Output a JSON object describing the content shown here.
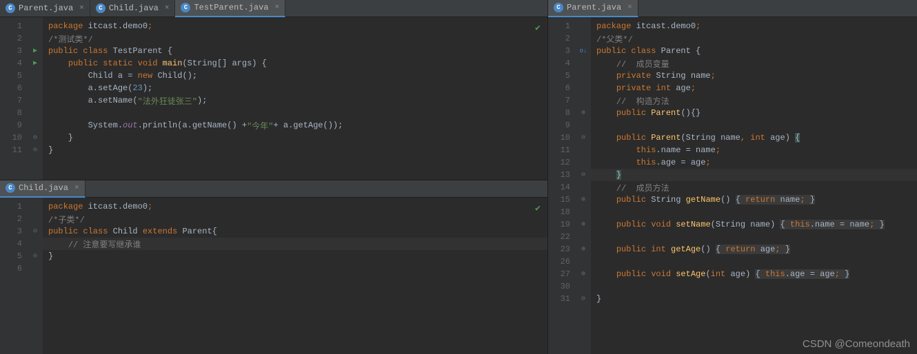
{
  "tabs": {
    "topLeft": [
      {
        "label": "Parent.java",
        "active": false
      },
      {
        "label": "Child.java",
        "active": false
      },
      {
        "label": "TestParent.java",
        "active": true
      }
    ],
    "botLeft": [
      {
        "label": "Child.java",
        "active": true
      }
    ],
    "right": [
      {
        "label": "Parent.java",
        "active": true
      }
    ]
  },
  "code": {
    "topLeft": {
      "lines": [
        {
          "n": 1,
          "seg": [
            {
              "t": "package ",
              "c": "kw"
            },
            {
              "t": "itcast.demo0"
            },
            {
              "t": ";",
              "c": "kw"
            }
          ]
        },
        {
          "n": 2,
          "seg": [
            {
              "t": "/*测试类*/",
              "c": "cmt"
            }
          ]
        },
        {
          "n": 3,
          "g": "run",
          "f": "−",
          "seg": [
            {
              "t": "public class ",
              "c": "kw"
            },
            {
              "t": "TestParent"
            },
            {
              "t": " {"
            }
          ]
        },
        {
          "n": 4,
          "g": "run",
          "f": "−",
          "seg": [
            {
              "t": "    "
            },
            {
              "t": "public static void ",
              "c": "kw"
            },
            {
              "t": "main",
              "c": "fn"
            },
            {
              "t": "(String[] args) {"
            }
          ]
        },
        {
          "n": 5,
          "seg": [
            {
              "t": "        Child a = "
            },
            {
              "t": "new ",
              "c": "kw"
            },
            {
              "t": "Child();"
            }
          ]
        },
        {
          "n": 6,
          "seg": [
            {
              "t": "        a.setAge("
            },
            {
              "t": "23",
              "c": "num"
            },
            {
              "t": ");"
            }
          ]
        },
        {
          "n": 7,
          "seg": [
            {
              "t": "        a.setName("
            },
            {
              "t": "\"法外狂徒张三\"",
              "c": "str"
            },
            {
              "t": ");"
            }
          ]
        },
        {
          "n": 8,
          "seg": [
            {
              "t": ""
            }
          ]
        },
        {
          "n": 9,
          "seg": [
            {
              "t": "        System."
            },
            {
              "t": "out",
              "c": "it"
            },
            {
              "t": ".println(a.getName() +"
            },
            {
              "t": "\"今年\"",
              "c": "str"
            },
            {
              "t": "+ a.getAge());"
            }
          ]
        },
        {
          "n": 10,
          "f": "−",
          "seg": [
            {
              "t": "    }"
            }
          ]
        },
        {
          "n": 11,
          "f": "−",
          "seg": [
            {
              "t": "}"
            }
          ]
        }
      ]
    },
    "botLeft": {
      "lines": [
        {
          "n": 1,
          "seg": [
            {
              "t": "package ",
              "c": "kw"
            },
            {
              "t": "itcast.demo0"
            },
            {
              "t": ";",
              "c": "kw"
            }
          ]
        },
        {
          "n": 2,
          "seg": [
            {
              "t": "/*子类*/",
              "c": "cmt"
            }
          ]
        },
        {
          "n": 3,
          "f": "−",
          "seg": [
            {
              "t": "public class ",
              "c": "kw"
            },
            {
              "t": "Child"
            },
            {
              "t": " extends ",
              "c": "kw"
            },
            {
              "t": "Parent"
            },
            {
              "t": "{"
            }
          ]
        },
        {
          "n": 4,
          "hl": true,
          "seg": [
            {
              "t": "    "
            },
            {
              "t": "// 注意要写继承谁",
              "c": "cmt"
            }
          ]
        },
        {
          "n": 5,
          "f": "−",
          "seg": [
            {
              "t": "}"
            }
          ]
        },
        {
          "n": 6,
          "seg": [
            {
              "t": ""
            }
          ]
        }
      ]
    },
    "right": {
      "lines": [
        {
          "n": 1,
          "seg": [
            {
              "t": "package ",
              "c": "kw"
            },
            {
              "t": "itcast.demo0"
            },
            {
              "t": ";",
              "c": "kw"
            }
          ]
        },
        {
          "n": 2,
          "seg": [
            {
              "t": "/*父类*/",
              "c": "cmt"
            }
          ]
        },
        {
          "n": 3,
          "g": "override",
          "f": "−",
          "seg": [
            {
              "t": "public class ",
              "c": "kw"
            },
            {
              "t": "Parent"
            },
            {
              "t": " {"
            }
          ]
        },
        {
          "n": 4,
          "seg": [
            {
              "t": "    "
            },
            {
              "t": "//  成员变量",
              "c": "cmt"
            }
          ]
        },
        {
          "n": 5,
          "seg": [
            {
              "t": "    "
            },
            {
              "t": "private ",
              "c": "kw"
            },
            {
              "t": "String name"
            },
            {
              "t": ";",
              "c": "kw"
            }
          ]
        },
        {
          "n": 6,
          "seg": [
            {
              "t": "    "
            },
            {
              "t": "private int ",
              "c": "kw"
            },
            {
              "t": "age"
            },
            {
              "t": ";",
              "c": "kw"
            }
          ]
        },
        {
          "n": 7,
          "seg": [
            {
              "t": "    "
            },
            {
              "t": "//  构造方法",
              "c": "cmt"
            }
          ]
        },
        {
          "n": 8,
          "f": "+",
          "seg": [
            {
              "t": "    "
            },
            {
              "t": "public ",
              "c": "kw"
            },
            {
              "t": "Parent",
              "c": "fn"
            },
            {
              "t": "(){}"
            }
          ]
        },
        {
          "n": 9,
          "seg": [
            {
              "t": ""
            }
          ]
        },
        {
          "n": 10,
          "f": "−",
          "seg": [
            {
              "t": "    "
            },
            {
              "t": "public ",
              "c": "kw"
            },
            {
              "t": "Parent",
              "c": "fn"
            },
            {
              "t": "(String name"
            },
            {
              "t": ", ",
              "c": "kw"
            },
            {
              "t": "int ",
              "c": "kw"
            },
            {
              "t": "age) "
            },
            {
              "t": "{",
              "c": "hlbr"
            }
          ]
        },
        {
          "n": 11,
          "seg": [
            {
              "t": "        "
            },
            {
              "t": "this",
              "c": "kw"
            },
            {
              "t": ".name = name"
            },
            {
              "t": ";",
              "c": "kw"
            }
          ]
        },
        {
          "n": 12,
          "seg": [
            {
              "t": "        "
            },
            {
              "t": "this",
              "c": "kw"
            },
            {
              "t": ".age = age"
            },
            {
              "t": ";",
              "c": "kw"
            }
          ]
        },
        {
          "n": 13,
          "f": "−",
          "hl": true,
          "seg": [
            {
              "t": "    "
            },
            {
              "t": "}",
              "c": "hlbr"
            }
          ]
        },
        {
          "n": 14,
          "seg": [
            {
              "t": "    "
            },
            {
              "t": "//  成员方法",
              "c": "cmt"
            }
          ]
        },
        {
          "n": 15,
          "f": "+",
          "seg": [
            {
              "t": "    "
            },
            {
              "t": "public ",
              "c": "kw"
            },
            {
              "t": "String "
            },
            {
              "t": "getName",
              "c": "fn"
            },
            {
              "t": "() "
            },
            {
              "t": "{ ",
              "c": "bg"
            },
            {
              "t": "return ",
              "c": "kw bg"
            },
            {
              "t": "name",
              "c": "bg"
            },
            {
              "t": "; ",
              "c": "kw bg"
            },
            {
              "t": "}",
              "c": "bg"
            }
          ]
        },
        {
          "n": 18,
          "seg": [
            {
              "t": ""
            }
          ]
        },
        {
          "n": 19,
          "f": "+",
          "seg": [
            {
              "t": "    "
            },
            {
              "t": "public void ",
              "c": "kw"
            },
            {
              "t": "setName",
              "c": "fn"
            },
            {
              "t": "(String name) "
            },
            {
              "t": "{ ",
              "c": "bg"
            },
            {
              "t": "this",
              "c": "kw bg"
            },
            {
              "t": ".name = name",
              "c": "bg"
            },
            {
              "t": "; ",
              "c": "kw bg"
            },
            {
              "t": "}",
              "c": "bg"
            }
          ]
        },
        {
          "n": 22,
          "seg": [
            {
              "t": ""
            }
          ]
        },
        {
          "n": 23,
          "f": "+",
          "seg": [
            {
              "t": "    "
            },
            {
              "t": "public int ",
              "c": "kw"
            },
            {
              "t": "getAge",
              "c": "fn"
            },
            {
              "t": "() "
            },
            {
              "t": "{ ",
              "c": "bg"
            },
            {
              "t": "return ",
              "c": "kw bg"
            },
            {
              "t": "age",
              "c": "bg"
            },
            {
              "t": "; ",
              "c": "kw bg"
            },
            {
              "t": "}",
              "c": "bg"
            }
          ]
        },
        {
          "n": 26,
          "seg": [
            {
              "t": ""
            }
          ]
        },
        {
          "n": 27,
          "f": "+",
          "seg": [
            {
              "t": "    "
            },
            {
              "t": "public void ",
              "c": "kw"
            },
            {
              "t": "setAge",
              "c": "fn"
            },
            {
              "t": "("
            },
            {
              "t": "int ",
              "c": "kw"
            },
            {
              "t": "age) "
            },
            {
              "t": "{ ",
              "c": "bg"
            },
            {
              "t": "this",
              "c": "kw bg"
            },
            {
              "t": ".age = age",
              "c": "bg"
            },
            {
              "t": "; ",
              "c": "kw bg"
            },
            {
              "t": "}",
              "c": "bg"
            }
          ]
        },
        {
          "n": 30,
          "seg": [
            {
              "t": ""
            }
          ]
        },
        {
          "n": 31,
          "f": "−",
          "seg": [
            {
              "t": "}"
            }
          ]
        }
      ]
    }
  },
  "watermark": "CSDN @Comeondeath"
}
